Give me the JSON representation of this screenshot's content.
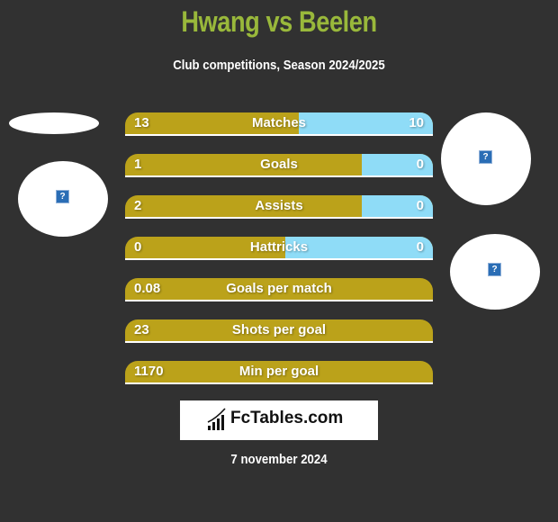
{
  "header": {
    "title": "Hwang vs Beelen",
    "subtitle": "Club competitions, Season 2024/2025"
  },
  "colors": {
    "title": "#99b83b",
    "left_bar": "#bba21a",
    "right_bar": "#8fdcf7",
    "background": "#313131"
  },
  "stats": [
    {
      "label": "Matches",
      "left": "13",
      "right": "10",
      "right_fraction": 0.435
    },
    {
      "label": "Goals",
      "left": "1",
      "right": "0",
      "right_fraction": 0.23
    },
    {
      "label": "Assists",
      "left": "2",
      "right": "0",
      "right_fraction": 0.23
    },
    {
      "label": "Hattricks",
      "left": "0",
      "right": "0",
      "right_fraction": 0.48
    },
    {
      "label": "Goals per match",
      "left": "0.08",
      "right": "",
      "right_fraction": 0
    },
    {
      "label": "Shots per goal",
      "left": "23",
      "right": "",
      "right_fraction": 0
    },
    {
      "label": "Min per goal",
      "left": "1170",
      "right": "",
      "right_fraction": 0
    }
  ],
  "images": {
    "placeholder_icon": "?"
  },
  "footer": {
    "brand": "FcTables.com",
    "date": "7 november 2024"
  }
}
